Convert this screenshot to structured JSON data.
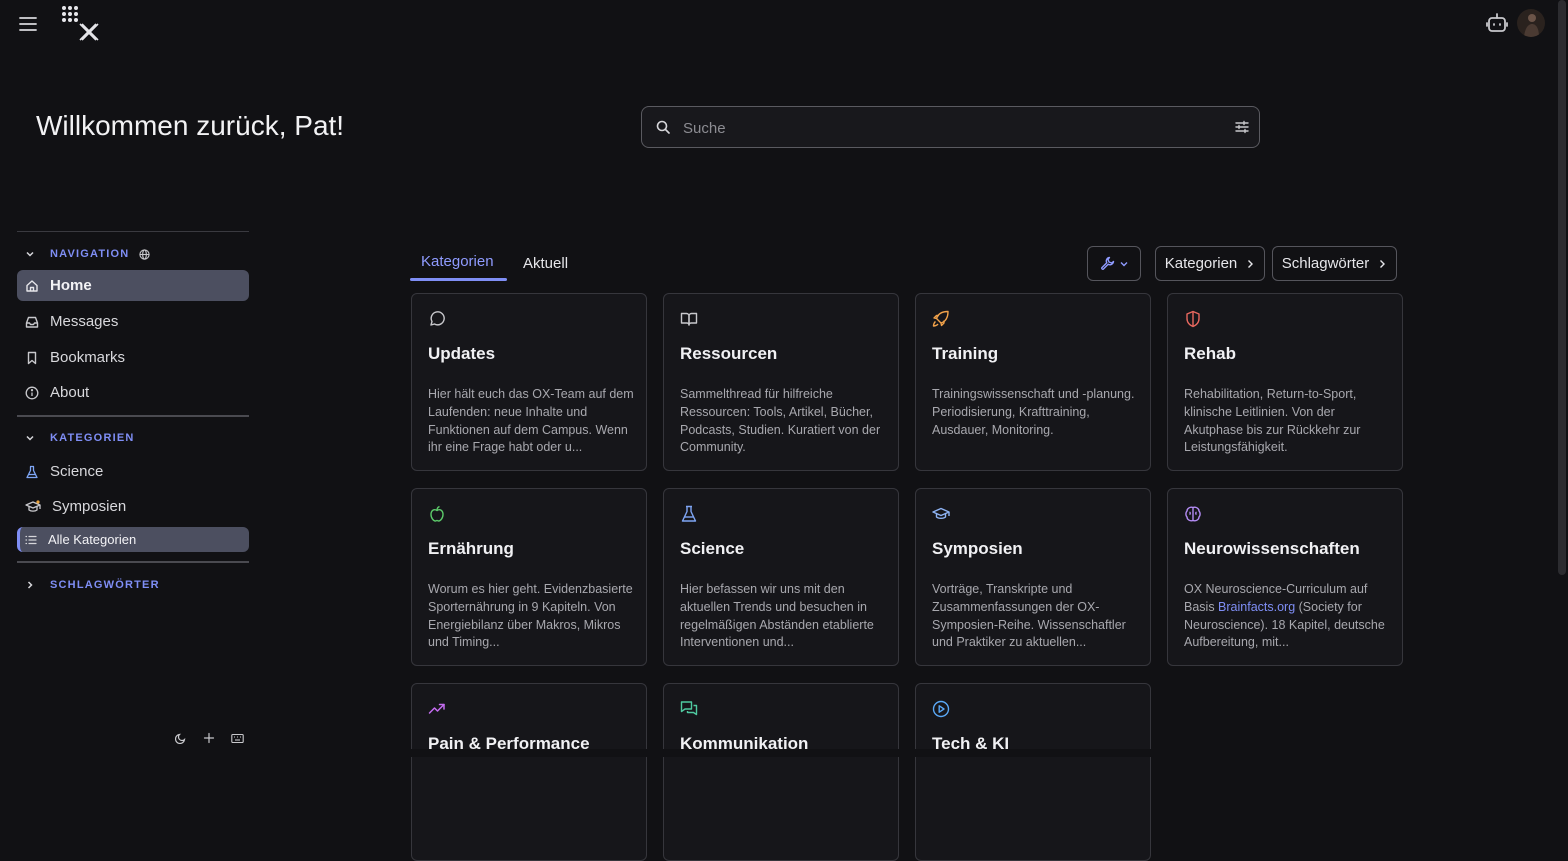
{
  "header": {
    "menu_icon": "hamburger-menu-icon",
    "logo_icon": "ox-logo-icon",
    "assistant_icon": "robot-icon",
    "avatar_icon": "user-avatar-icon"
  },
  "greeting": "Willkommen zurück, Pat!",
  "search": {
    "placeholder": "Suche"
  },
  "sidebar": {
    "navigation": {
      "heading": "NAVIGATION",
      "items": [
        {
          "label": "Home",
          "icon": "home-icon",
          "active": true
        },
        {
          "label": "Messages",
          "icon": "inbox-icon"
        },
        {
          "label": "Bookmarks",
          "icon": "bookmark-icon"
        },
        {
          "label": "About",
          "icon": "info-icon"
        }
      ]
    },
    "kategorien": {
      "heading": "KATEGORIEN",
      "items": [
        {
          "label": "Science",
          "icon": "flask-icon"
        },
        {
          "label": "Symposien",
          "icon": "graduation-cap-icon"
        },
        {
          "label": "Alle Kategorien",
          "icon": "list-icon",
          "active": true
        }
      ]
    },
    "schlagwoerter": {
      "heading": "SCHLAGWÖRTER"
    }
  },
  "tabs": [
    {
      "label": "Kategorien",
      "active": true
    },
    {
      "label": "Aktuell"
    }
  ],
  "filters": {
    "tools_icon": "wrench-icon",
    "kategorien": "Kategorien",
    "schlagwoerter": "Schlagwörter"
  },
  "cards": [
    {
      "title": "Updates",
      "icon": "chat-bubble-icon",
      "color": "#c8c8cc",
      "desc": "Hier hält euch das OX-Team auf dem Laufenden: neue Inhalte und Funktionen auf dem Campus. Wenn ihr eine Frage habt oder u..."
    },
    {
      "title": "Ressourcen",
      "icon": "book-open-icon",
      "color": "#c8c8cc",
      "desc": "Sammelthread für hilfreiche Ressourcen: Tools, Artikel, Bücher, Podcasts, Studien. Kuratiert von der Community."
    },
    {
      "title": "Training",
      "icon": "rocket-icon",
      "color": "#f2a24a",
      "desc": "Trainingswissenschaft und -planung. Periodisierung, Krafttraining, Ausdauer, Monitoring."
    },
    {
      "title": "Rehab",
      "icon": "shield-icon",
      "color": "#e8685f",
      "desc": "Rehabilitation, Return-to-Sport, klinische Leitlinien. Von der Akutphase bis zur Rückkehr zur Leistungsfähigkeit."
    },
    {
      "title": "Ernährung",
      "icon": "apple-icon",
      "color": "#5cc96a",
      "desc": "Worum es hier geht. Evidenzbasierte Sporternährung in 9 Kapiteln. Von Energiebilanz über Makros, Mikros und Timing..."
    },
    {
      "title": "Science",
      "icon": "flask-icon",
      "color": "#7fa6f5",
      "desc": "Hier befassen wir uns mit den aktuellen Trends und besuchen in regelmäßigen Abständen etablierte Interventionen und..."
    },
    {
      "title": "Symposien",
      "icon": "graduation-cap-icon",
      "color": "#8fb4f5",
      "desc": "Vorträge, Transkripte und Zusammenfassungen der OX-Symposien-Reihe. Wissenschaftler und Praktiker zu aktuellen..."
    },
    {
      "title": "Neurowissenschaften",
      "icon": "brain-icon",
      "color": "#b48cf5",
      "desc_before": "OX Neuroscience-Curriculum auf Basis ",
      "desc_link": "Brainfacts.org",
      "desc_after": " (Society for Neuroscience). 18 Kapitel, deutsche Aufbereitung, mit..."
    },
    {
      "title": "Pain & Performance",
      "icon": "trending-up-icon",
      "color": "#c46cf0"
    },
    {
      "title": "Kommunikation",
      "icon": "messages-icon",
      "color": "#4fc9a0"
    },
    {
      "title": "Tech & KI",
      "icon": "play-circle-icon",
      "color": "#5aa8f5"
    }
  ],
  "footer_icons": [
    "moon-icon",
    "plus-icon",
    "keyboard-icon"
  ]
}
